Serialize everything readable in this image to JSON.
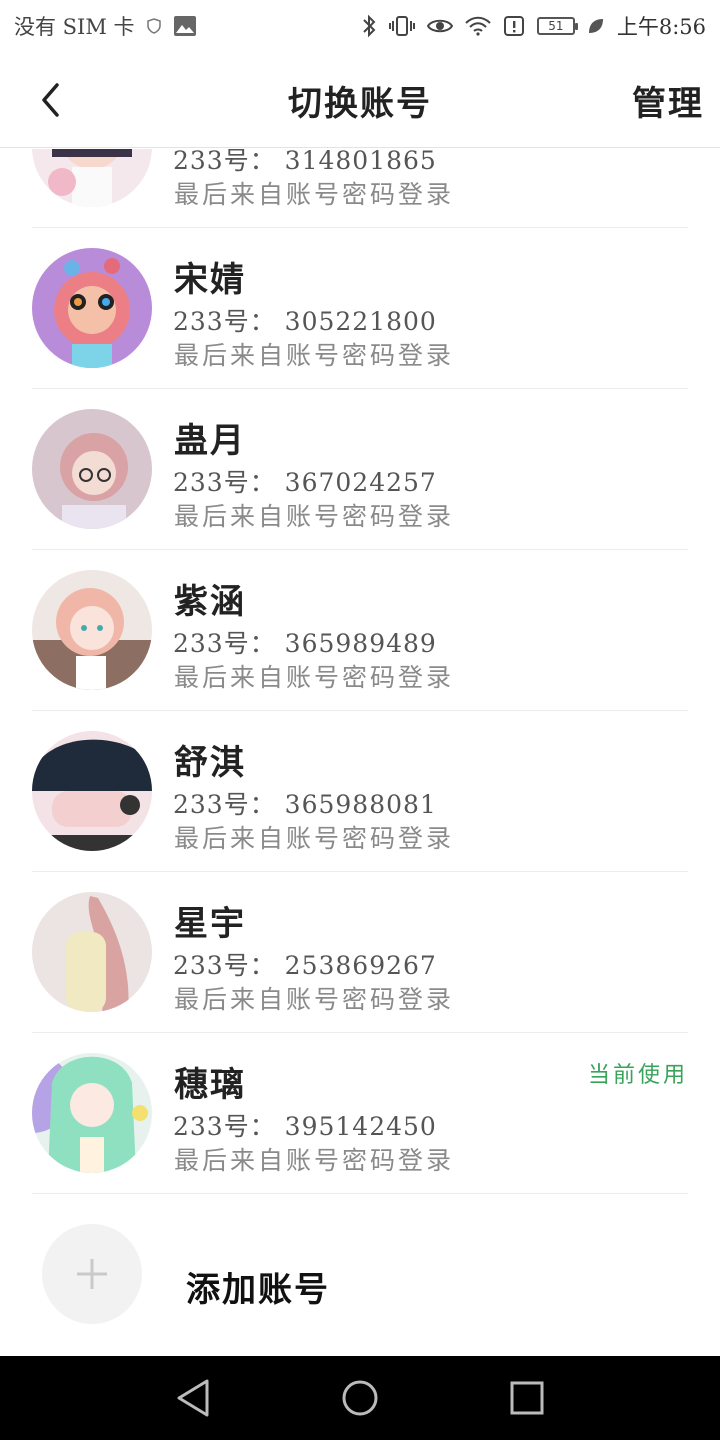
{
  "status_bar": {
    "carrier": "没有 SIM 卡",
    "time": "上午8:56",
    "battery_level": "51",
    "icons": [
      "shield-icon",
      "image-icon",
      "bluetooth-icon",
      "vibrate-icon",
      "eye-icon",
      "wifi-icon",
      "alert-icon",
      "battery-icon",
      "leaf-icon"
    ]
  },
  "nav": {
    "back_icon": "chevron-left-icon",
    "title": "切换账号",
    "manage_label": "管理"
  },
  "accounts": [
    {
      "name": "",
      "uid": "233号： 314801865",
      "last_login": "最后来自账号密码登录",
      "current": ""
    },
    {
      "name": "宋婧",
      "uid": "233号： 305221800",
      "last_login": "最后来自账号密码登录",
      "current": ""
    },
    {
      "name": "蛊月",
      "uid": "233号： 367024257",
      "last_login": "最后来自账号密码登录",
      "current": ""
    },
    {
      "name": "紫涵",
      "uid": "233号： 365989489",
      "last_login": "最后来自账号密码登录",
      "current": ""
    },
    {
      "name": "舒淇",
      "uid": "233号： 365988081",
      "last_login": "最后来自账号密码登录",
      "current": ""
    },
    {
      "name": "星宇",
      "uid": "233号： 253869267",
      "last_login": "最后来自账号密码登录",
      "current": ""
    },
    {
      "name": "穗璃",
      "uid": "233号： 395142450",
      "last_login": "最后来自账号密码登录",
      "current": "当前使用"
    }
  ],
  "add_account": {
    "label": "添加账号",
    "icon": "plus-icon"
  },
  "colors": {
    "accent_green": "#3aa35a",
    "divider": "#ececec"
  },
  "system_nav": {
    "icons": [
      "back-triangle-icon",
      "home-circle-icon",
      "recents-square-icon"
    ]
  }
}
